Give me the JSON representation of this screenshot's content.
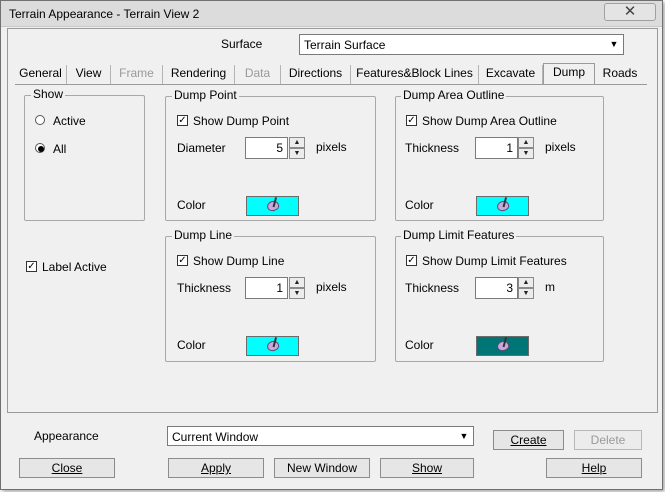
{
  "window": {
    "title": "Terrain Appearance - Terrain View 2",
    "close_glyph": "✕"
  },
  "surface": {
    "label": "Surface",
    "value": "Terrain Surface"
  },
  "tabs": [
    {
      "label": "General",
      "state": "normal"
    },
    {
      "label": "View",
      "state": "normal"
    },
    {
      "label": "Frame",
      "state": "disabled"
    },
    {
      "label": "Rendering",
      "state": "normal"
    },
    {
      "label": "Data",
      "state": "disabled"
    },
    {
      "label": "Directions",
      "state": "normal"
    },
    {
      "label": "Features&Block Lines",
      "state": "normal"
    },
    {
      "label": "Excavate",
      "state": "normal"
    },
    {
      "label": "Dump",
      "state": "active"
    },
    {
      "label": "Roads",
      "state": "normal"
    }
  ],
  "show_group": {
    "title": "Show",
    "options": [
      {
        "label": "Active",
        "checked": false
      },
      {
        "label": "All",
        "checked": true
      }
    ]
  },
  "label_active": {
    "label": "Label Active",
    "checked": true
  },
  "dump_point": {
    "title": "Dump Point",
    "checkbox_label": "Show Dump Point",
    "checked": true,
    "field_label": "Diameter",
    "value": "5",
    "unit": "pixels",
    "color_label": "Color",
    "color": "#00ffff"
  },
  "dump_area_outline": {
    "title": "Dump Area Outline",
    "checkbox_label": "Show Dump Area Outline",
    "checked": true,
    "field_label": "Thickness",
    "value": "1",
    "unit": "pixels",
    "color_label": "Color",
    "color": "#00ffff"
  },
  "dump_line": {
    "title": "Dump Line",
    "checkbox_label": "Show Dump Line",
    "checked": true,
    "field_label": "Thickness",
    "value": "1",
    "unit": "pixels",
    "color_label": "Color",
    "color": "#00ffff"
  },
  "dump_limit_features": {
    "title": "Dump Limit Features",
    "checkbox_label": "Show Dump Limit Features",
    "checked": true,
    "field_label": "Thickness",
    "value": "3",
    "unit": "m",
    "color_label": "Color",
    "color": "#007575"
  },
  "appearance": {
    "label": "Appearance",
    "value": "Current Window"
  },
  "buttons": {
    "create": "Create",
    "delete": "Delete",
    "close": "Close",
    "apply": "Apply",
    "new_window": "New Window",
    "show": "Show",
    "help": "Help"
  },
  "glyphs": {
    "check": "✓",
    "dropdown": "▼",
    "spin_up": "▲",
    "spin_down": "▼"
  }
}
